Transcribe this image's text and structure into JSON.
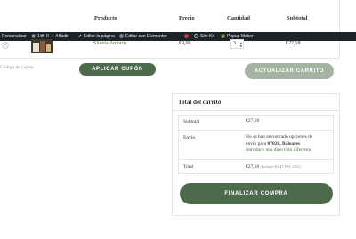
{
  "cart_table": {
    "headers": [
      "Producto",
      "Precio",
      "Cantidad",
      "Subtotal"
    ]
  },
  "admin_bar": {
    "items": [
      {
        "label": "Personalizar",
        "icon": "brush-icon"
      },
      {
        "label": "1",
        "icon": "counter-icon"
      },
      {
        "label": "0",
        "icon": "comment-icon"
      },
      {
        "label": "Añadir",
        "icon": "plus-icon"
      },
      {
        "label": "Editar la página",
        "icon": "pencil-icon"
      },
      {
        "label": "Editar con Elementor",
        "icon": "elementor-icon"
      },
      {
        "label": "Site Kit",
        "icon": "google-icon"
      },
      {
        "label": "Popup Maker",
        "icon": "popup-maker-icon"
      }
    ],
    "status_dot_color": "#d63638"
  },
  "cart_item": {
    "remove_symbol": "×",
    "name": "Silueta Arcoíris",
    "price": "€9,06",
    "quantity": "3",
    "subtotal": "€27,18"
  },
  "coupon": {
    "placeholder": "Código de cupón",
    "apply_label": "APLICAR CUPÓN",
    "update_label": "ACTUALIZAR CARRITO"
  },
  "totals": {
    "title": "Total del carrito",
    "subtotal_label": "Subtotal",
    "subtotal_value": "€27,18",
    "shipping_label": "Envío",
    "shipping_text_1": "No se han encontrado opciones de",
    "shipping_text_2": "envío para",
    "shipping_location": "07020, Baleares",
    "shipping_link": "Introduce una dirección diferente",
    "total_label": "Total",
    "total_value": "€27,18",
    "total_note": "(incluye €3,47 IVA 15%)",
    "checkout_label": "FINALIZAR COMPRA"
  },
  "colors": {
    "accent_green": "#4d6b4c",
    "link_green": "#3f7a2e",
    "muted_button": "#a4b4a2",
    "admin_bar": "#1d2327"
  }
}
